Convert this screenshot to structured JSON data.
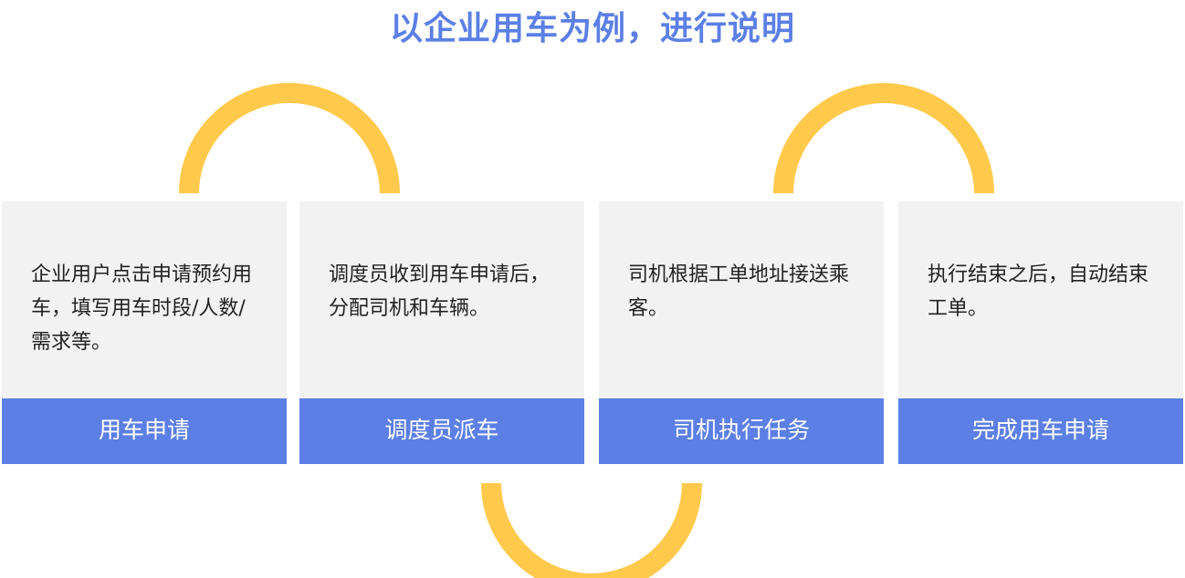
{
  "title": "以企业用车为例，进行说明",
  "steps": [
    {
      "description": "企业用户点击申请预约用车，填写用车时段/人数/需求等。",
      "label": "用车申请"
    },
    {
      "description": "调度员收到用车申请后，分配司机和车辆。",
      "label": "调度员派车"
    },
    {
      "description": "司机根据工单地址接送乘客。",
      "label": "司机执行任务"
    },
    {
      "description": "执行结束之后，自动结束工单。",
      "label": "完成用车申请"
    }
  ],
  "colors": {
    "title": "#5b7fe4",
    "label_bg": "#5b7fe4",
    "card_bg": "#f2f2f2",
    "arc": "#ffc94c"
  }
}
